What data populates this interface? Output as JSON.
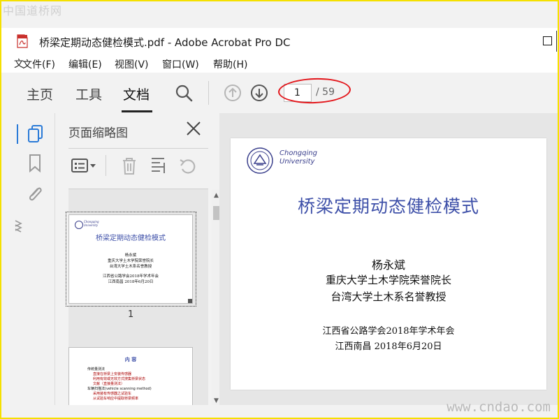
{
  "watermark_top": "中国道桥网",
  "watermark_bottom": "www.cndao.com",
  "window": {
    "title": "桥梁定期动态健检模式.pdf - Adobe Acrobat Pro DC"
  },
  "menu": {
    "stub": "文",
    "items": [
      "文件(F)",
      "编辑(E)",
      "视图(V)",
      "窗口(W)",
      "帮助(H)"
    ]
  },
  "toolbar": {
    "tabs": [
      "主页",
      "工具",
      "文档"
    ],
    "active_tab": "文档",
    "page_current": "1",
    "page_total": "/ 59"
  },
  "panel": {
    "title": "页面缩略图",
    "thumb1_label": "1"
  },
  "thumb1": {
    "logo": [
      "Chongqing",
      "University"
    ],
    "title": "桥梁定期动态健检模式",
    "lines": [
      "杨永斌",
      "重庆大学土木学院荣誉院长",
      "台湾大学土木系名誉教授",
      "江西省公路学会2018年学术年会",
      "江西南昌 2018年6月20日"
    ]
  },
  "thumb2": {
    "title": "内 容",
    "lines": [
      "传统量测法",
      "直接在桥梁上安装传感器",
      "利用有效或无效方式搜集桥梁状态",
      "文献（直接量测法）",
      "车辆扫描法(vehicle scanning method)",
      "采用装有传感器之试验车",
      "从试验车响应中提取桥梁频率"
    ]
  },
  "document": {
    "logo": [
      "Chongqing",
      "University"
    ],
    "title": "桥梁定期动态健检模式",
    "author": "杨永斌",
    "affil1": "重庆大学土木学院荣誉院长",
    "affil2": "台湾大学土木系名誉教授",
    "event": "江西省公路学会2018年学术年会",
    "place_date": "江西南昌  2018年6月20日"
  },
  "colors": {
    "accent_blue": "#2a7ad7",
    "title_blue": "#3d4fa8",
    "annotation_red": "#e3151a",
    "border_yellow": "#f5e000"
  }
}
